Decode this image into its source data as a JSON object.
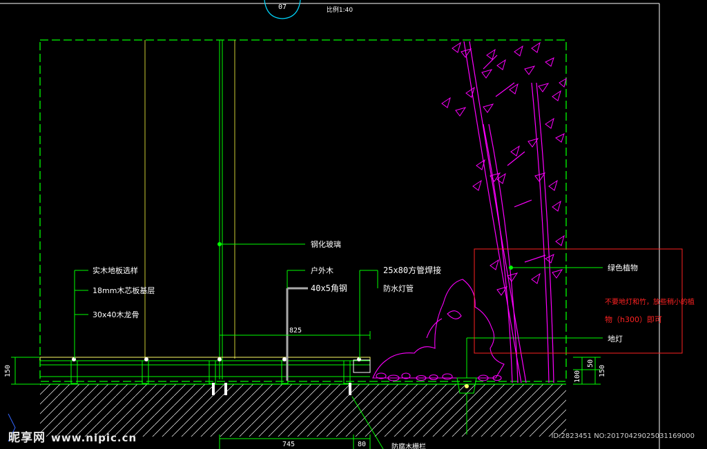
{
  "title_bubble": "07",
  "scale_text": "比例1:40",
  "labels": {
    "glass": "钢化玻璃",
    "floor_finish": "实木地板选样",
    "base_layer": "18mm木芯板基层",
    "keel": "30x40木龙骨",
    "outdoor_wood": "户外木",
    "angle_steel": "40x5角钢",
    "tube_weld": "25x80方管焊接",
    "waterproof_lamp": "防水灯管",
    "green_plant": "绿色植物",
    "ground_lamp": "地灯",
    "bottom_cut": "防腐木栅栏"
  },
  "note_red": [
    "不要地灯和竹，放些稍小的植",
    "物（h300）即可"
  ],
  "dimensions": {
    "left_150": "150",
    "span_825": "825",
    "span_745": "745",
    "span_80": "80",
    "right_100": "100",
    "right_50": "50",
    "right_150": "150"
  },
  "watermark": {
    "brand": "昵享网",
    "site": "www.nipic.cn",
    "id": "ID:2823451 NO:20170429025031169000"
  },
  "colors": {
    "background": "#000000",
    "structure": "#00ff00",
    "plants": "#ff00ff",
    "wood": "#ffff66",
    "highlight_box": "#ff2222",
    "dimension": "#ffffff",
    "bubble": "#00d8ff"
  }
}
